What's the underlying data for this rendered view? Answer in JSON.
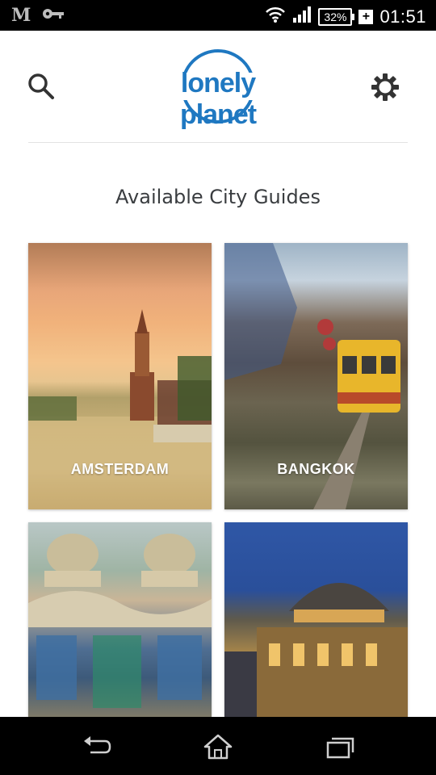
{
  "status_bar": {
    "time": "01:51",
    "battery": "32%",
    "carrier_glyph": "M",
    "icons": [
      "key-icon",
      "wifi-icon",
      "signal-icon",
      "battery-icon",
      "charging-plus-icon"
    ]
  },
  "header": {
    "logo_text": "lonely planet",
    "icons": [
      "search-icon",
      "settings-gear-icon"
    ]
  },
  "main": {
    "title": "Available City Guides",
    "cities": [
      {
        "label": "AMSTERDAM"
      },
      {
        "label": "BANGKOK"
      },
      {
        "label": ""
      },
      {
        "label": ""
      }
    ]
  },
  "nav_bar": {
    "icons": [
      "back-icon",
      "home-icon",
      "recent-apps-icon"
    ]
  },
  "colors": {
    "brand_blue": "#1f78c1",
    "status_bar_bg": "#000000",
    "nav_bar_bg": "#000000",
    "title_text": "#3a3d40"
  }
}
